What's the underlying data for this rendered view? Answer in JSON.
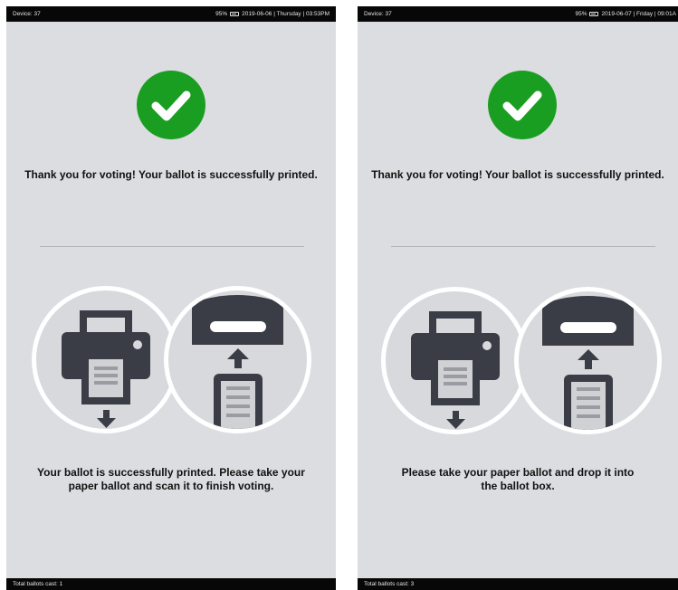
{
  "screens": [
    {
      "device": "Device: 37",
      "battery": "95%",
      "datetime": "2019-06-06 | Thursday | 03:53PM",
      "heading": "Thank you for voting! Your ballot is successfully printed.",
      "instruction": "Your ballot is successfully printed. Please take your paper ballot and scan it to finish voting.",
      "footer": "Total ballots cast: 1"
    },
    {
      "device": "Device: 37",
      "battery": "95%",
      "datetime": "2019-06-07 | Friday | 09:01A",
      "heading": "Thank you for voting! Your ballot is successfully printed.",
      "instruction": "Please take your paper ballot and drop it into the ballot box.",
      "footer": "Total ballots cast: 3"
    }
  ],
  "icons": {
    "success": "check-circle-icon",
    "printer": "printer-icon",
    "ballot_box": "ballot-box-icon"
  },
  "colors": {
    "success": "#1a9e22",
    "icon_dark": "#3a3d46",
    "screen_bg": "#dcdde0"
  }
}
